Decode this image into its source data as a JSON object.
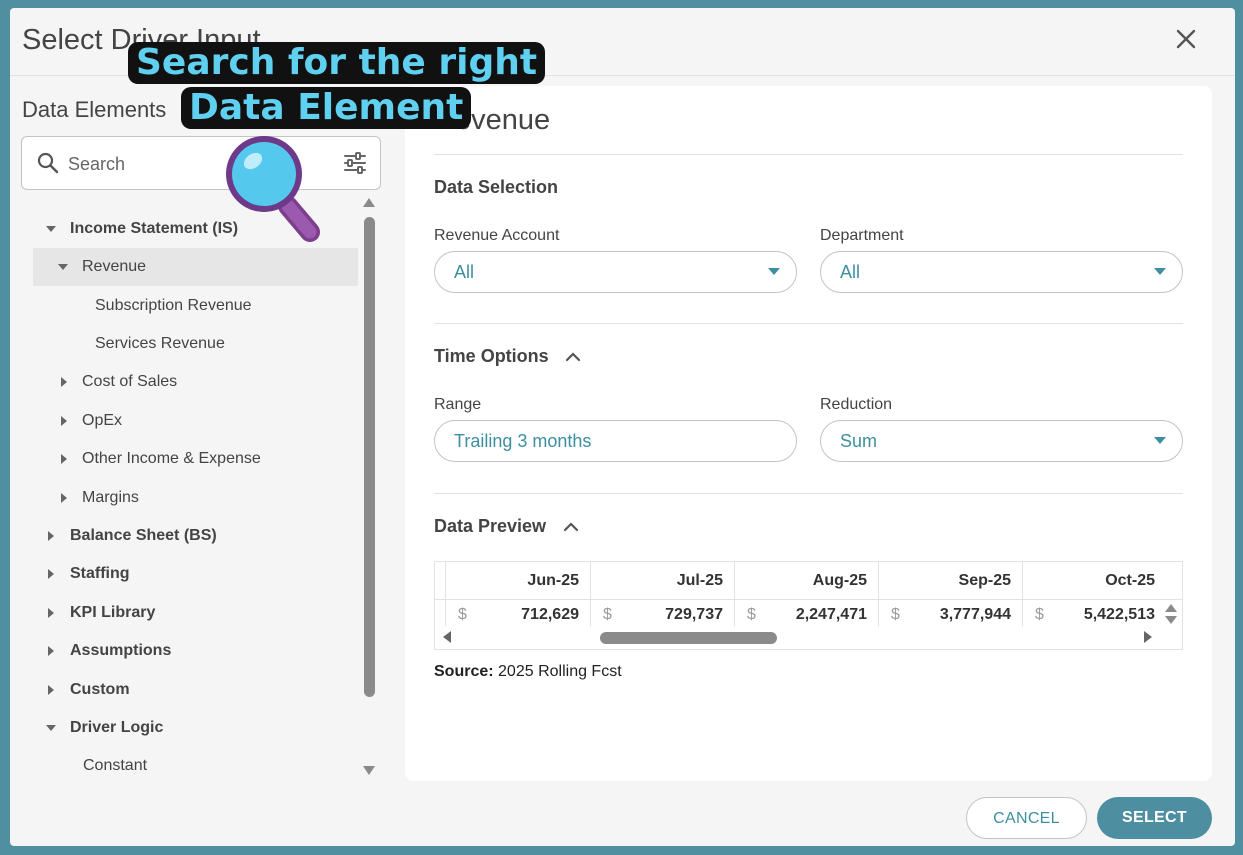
{
  "dialog": {
    "title": "Select Driver Input",
    "close_icon": "close-icon"
  },
  "sidebar": {
    "title": "Data Elements",
    "search": {
      "placeholder": "Search",
      "value": ""
    },
    "tree": [
      {
        "label": "Income Statement (IS)",
        "expanded": true,
        "level": 0
      },
      {
        "label": "Revenue",
        "expanded": true,
        "selected": true,
        "level": 1
      },
      {
        "label": "Subscription Revenue",
        "level": 2
      },
      {
        "label": "Services Revenue",
        "level": 2
      },
      {
        "label": "Cost of Sales",
        "expanded": false,
        "level": 1
      },
      {
        "label": "OpEx",
        "expanded": false,
        "level": 1
      },
      {
        "label": "Other Income & Expense",
        "expanded": false,
        "level": 1
      },
      {
        "label": "Margins",
        "expanded": false,
        "level": 1
      },
      {
        "label": "Balance Sheet (BS)",
        "expanded": false,
        "level": 0
      },
      {
        "label": "Staffing",
        "expanded": false,
        "level": 0
      },
      {
        "label": "KPI Library",
        "expanded": false,
        "level": 0
      },
      {
        "label": "Assumptions",
        "expanded": false,
        "level": 0
      },
      {
        "label": "Custom",
        "expanded": false,
        "level": 0
      },
      {
        "label": "Driver Logic",
        "expanded": true,
        "level": 0
      },
      {
        "label": "Constant",
        "level": 1
      }
    ]
  },
  "panel": {
    "title": "Revenue",
    "data_selection": {
      "title": "Data Selection",
      "revenue_account": {
        "label": "Revenue Account",
        "value": "All"
      },
      "department": {
        "label": "Department",
        "value": "All"
      }
    },
    "time_options": {
      "title": "Time Options",
      "range": {
        "label": "Range",
        "value": "Trailing 3 months"
      },
      "reduction": {
        "label": "Reduction",
        "value": "Sum"
      }
    },
    "data_preview": {
      "title": "Data Preview",
      "columns": [
        "Jun-25",
        "Jul-25",
        "Aug-25",
        "Sep-25",
        "Oct-25"
      ],
      "currency": "$",
      "values": [
        "712,629",
        "729,737",
        "2,247,471",
        "3,777,944",
        "5,422,513"
      ],
      "source_label": "Source:",
      "source_value": "2025 Rolling Fcst"
    }
  },
  "buttons": {
    "cancel": "CANCEL",
    "select": "SELECT"
  },
  "overlay": {
    "line1": "Search for the right",
    "line2": "Data Element",
    "icon": "magnifier-icon"
  },
  "colors": {
    "accent": "#3d8fa0",
    "primary_button": "#4d8ea0",
    "frame": "#4f8fa0",
    "callout_text": "#5fd0ef"
  }
}
